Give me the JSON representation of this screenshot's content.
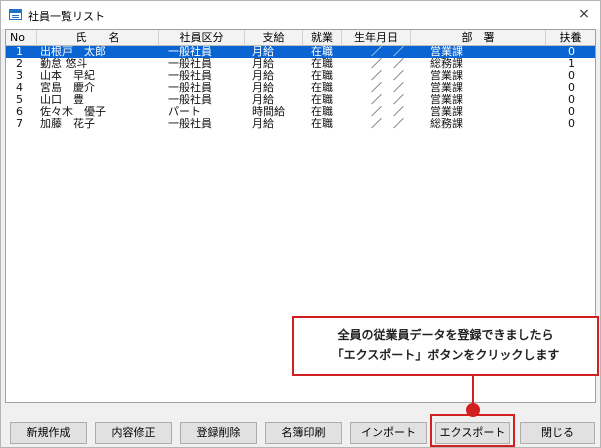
{
  "window": {
    "title": "社員一覧リスト",
    "close_label": "×"
  },
  "table": {
    "headers": [
      "No",
      "氏　　名",
      "社員区分",
      "支給",
      "就業",
      "生年月日",
      "部　署",
      "扶養"
    ],
    "rows": [
      {
        "no": "1",
        "name": "出根戸　太郎",
        "kubun": "一般社員",
        "shikyu": "月給",
        "shugyo": "在職",
        "birth": "／　／",
        "busho": "営業課",
        "fuyo": "0"
      },
      {
        "no": "2",
        "name": "勤怠 悠斗",
        "kubun": "一般社員",
        "shikyu": "月給",
        "shugyo": "在職",
        "birth": "／　／",
        "busho": "総務課",
        "fuyo": "1"
      },
      {
        "no": "3",
        "name": "山本　早紀",
        "kubun": "一般社員",
        "shikyu": "月給",
        "shugyo": "在職",
        "birth": "／　／",
        "busho": "営業課",
        "fuyo": "0"
      },
      {
        "no": "4",
        "name": "宮島　慶介",
        "kubun": "一般社員",
        "shikyu": "月給",
        "shugyo": "在職",
        "birth": "／　／",
        "busho": "営業課",
        "fuyo": "0"
      },
      {
        "no": "5",
        "name": "山口　豊",
        "kubun": "一般社員",
        "shikyu": "月給",
        "shugyo": "在職",
        "birth": "／　／",
        "busho": "営業課",
        "fuyo": "0"
      },
      {
        "no": "6",
        "name": "佐々木　優子",
        "kubun": "パート",
        "shikyu": "時間給",
        "shugyo": "在職",
        "birth": "／　／",
        "busho": "営業課",
        "fuyo": "0"
      },
      {
        "no": "7",
        "name": "加藤　花子",
        "kubun": "一般社員",
        "shikyu": "月給",
        "shugyo": "在職",
        "birth": "／　／",
        "busho": "総務課",
        "fuyo": "0"
      }
    ]
  },
  "callout": {
    "line1": "全員の従業員データを登録できましたら",
    "line2": "「エクスポート」ボタンをクリックします"
  },
  "buttons": {
    "new": "新規作成",
    "edit": "内容修正",
    "delete": "登録削除",
    "print": "名簿印刷",
    "import": "インポート",
    "export": "エクスポート",
    "close": "閉じる"
  },
  "colors": {
    "selection": "#0a64d2",
    "callout_accent": "#d22020"
  }
}
